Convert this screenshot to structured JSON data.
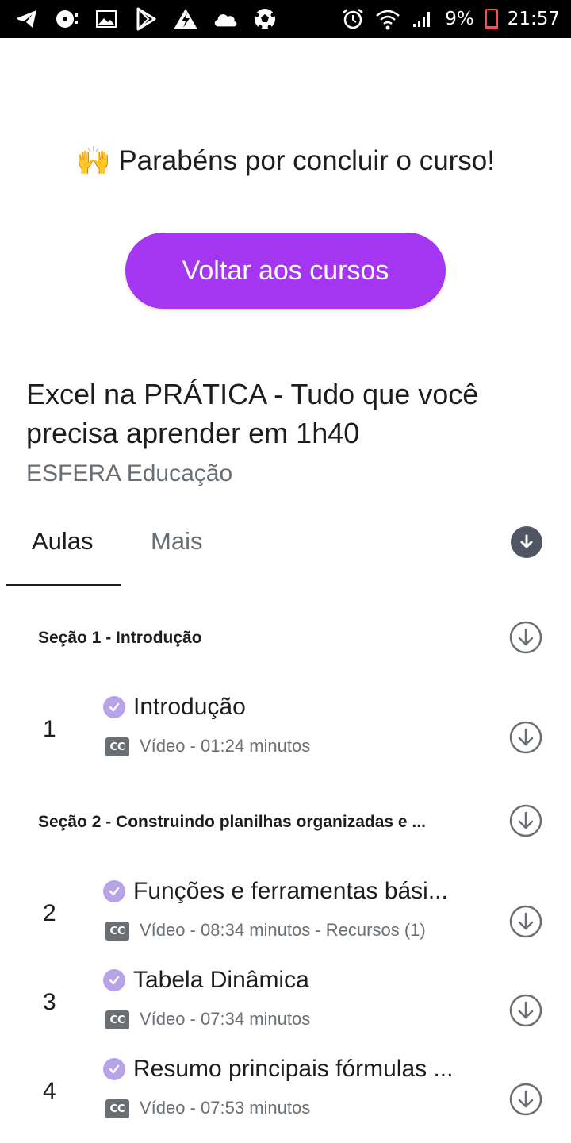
{
  "status_bar": {
    "battery": "9%",
    "time": "21:57",
    "left_icons": [
      "telegram-icon",
      "music-disc-icon",
      "image-icon",
      "play-store-icon",
      "app-icon",
      "cloud-icon",
      "soccer-ball-icon"
    ],
    "right_icons": [
      "alarm-icon",
      "wifi-icon",
      "signal-icon",
      "battery-icon"
    ]
  },
  "congrats": {
    "emoji": "🙌",
    "text": "Parabéns por concluir o curso!"
  },
  "back_button": {
    "label": "Voltar aos cursos"
  },
  "course": {
    "title": "Excel na PRÁTICA - Tudo que você precisa aprender em 1h40",
    "instructor": "ESFERA Educação"
  },
  "tabs": [
    {
      "label": "Aulas",
      "active": true
    },
    {
      "label": "Mais",
      "active": false
    }
  ],
  "sections": [
    {
      "title": "Seção 1 - Introdução",
      "lectures": [
        {
          "number": "1",
          "title": "Introdução",
          "cc": "CC",
          "meta": "Vídeo - 01:24 minutos"
        }
      ]
    },
    {
      "title": "Seção 2 - Construindo planilhas organizadas e ...",
      "lectures": [
        {
          "number": "2",
          "title": "Funções e ferramentas bási...",
          "cc": "CC",
          "meta": "Vídeo - 08:34 minutos - Recursos (1)"
        },
        {
          "number": "3",
          "title": "Tabela Dinâmica",
          "cc": "CC",
          "meta": "Vídeo - 07:34 minutos"
        },
        {
          "number": "4",
          "title": "Resumo principais fórmulas ...",
          "cc": "CC",
          "meta": "Vídeo - 07:53 minutos"
        }
      ]
    }
  ],
  "colors": {
    "accent": "#a435f0",
    "check": "#b6a3e8",
    "text": "#1c1d1f",
    "muted": "#6a6f73"
  }
}
